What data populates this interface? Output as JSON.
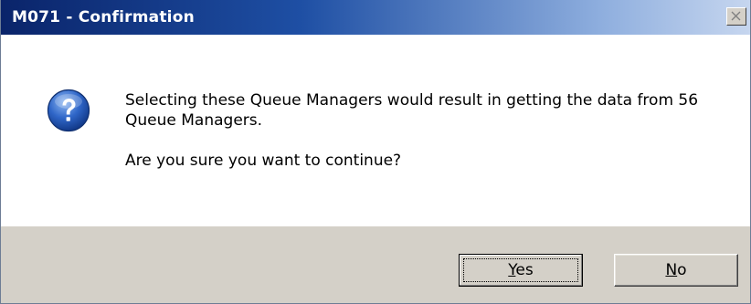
{
  "window": {
    "title": "M071 - Confirmation"
  },
  "message": {
    "line1": "Selecting these Queue Managers would result in getting the data from 56 Queue Managers.",
    "line2": "Are you sure you want to continue?"
  },
  "icons": {
    "message_icon": "question-icon",
    "close_icon": "close-icon"
  },
  "buttons": {
    "yes": {
      "mnemonic": "Y",
      "rest": "es"
    },
    "no": {
      "mnemonic": "N",
      "rest": "o"
    }
  },
  "colors": {
    "title_gradient_start": "#0a246a",
    "title_gradient_end": "#c6d6ef",
    "footer": "#d4d0c8",
    "icon_blue": "#2f66c8"
  }
}
